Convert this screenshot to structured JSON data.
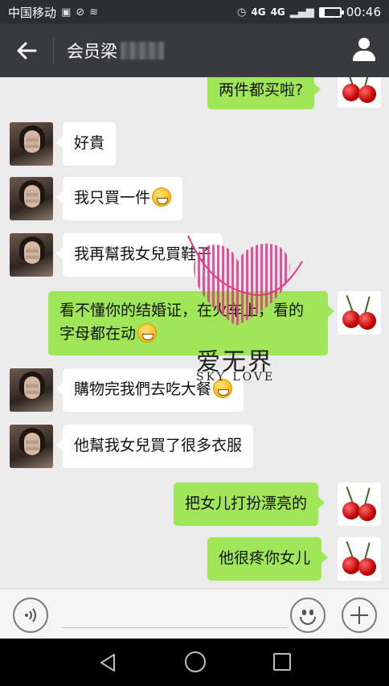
{
  "status_bar": {
    "carrier": "中国移动",
    "network_1": "4G",
    "network_2": "4G",
    "time": "00:46"
  },
  "header": {
    "back_icon": "arrow-left-icon",
    "title": "会员梁",
    "profile_icon": "person-icon"
  },
  "messages": [
    {
      "side": "out",
      "text": "两件都买啦?",
      "avatar": "cherry"
    },
    {
      "side": "in",
      "text": "好貴",
      "avatar": "person"
    },
    {
      "side": "in",
      "text": "我只買一件",
      "emoji": "grin",
      "avatar": "person"
    },
    {
      "side": "in",
      "text": "我再幫我女兒買鞋子",
      "avatar": "person"
    },
    {
      "side": "out",
      "text": "看不懂你的结婚证，在火车上，看的字母都在动",
      "emoji": "laugh-cry",
      "avatar": "cherry"
    },
    {
      "side": "in",
      "text": "購物完我們去吃大餐",
      "emoji": "grin",
      "avatar": "person"
    },
    {
      "side": "in",
      "text": "他幫我女兒買了很多衣服",
      "avatar": "person"
    },
    {
      "side": "out",
      "text": "把女儿打扮漂亮的",
      "avatar": "cherry"
    },
    {
      "side": "out",
      "text": "他很疼你女儿",
      "avatar": "cherry"
    }
  ],
  "watermark": {
    "text": "爱无界",
    "sub": "SKY LOVE"
  },
  "input_bar": {
    "voice_icon": "voice-icon",
    "emoji_icon": "smiley-icon",
    "plus_icon": "plus-icon",
    "placeholder": ""
  },
  "colors": {
    "out_bubble": "#9fe658",
    "in_bubble": "#ffffff",
    "title_bar": "#393a3f",
    "status_bar": "#2b2f33",
    "chat_bg": "#ebebeb"
  }
}
